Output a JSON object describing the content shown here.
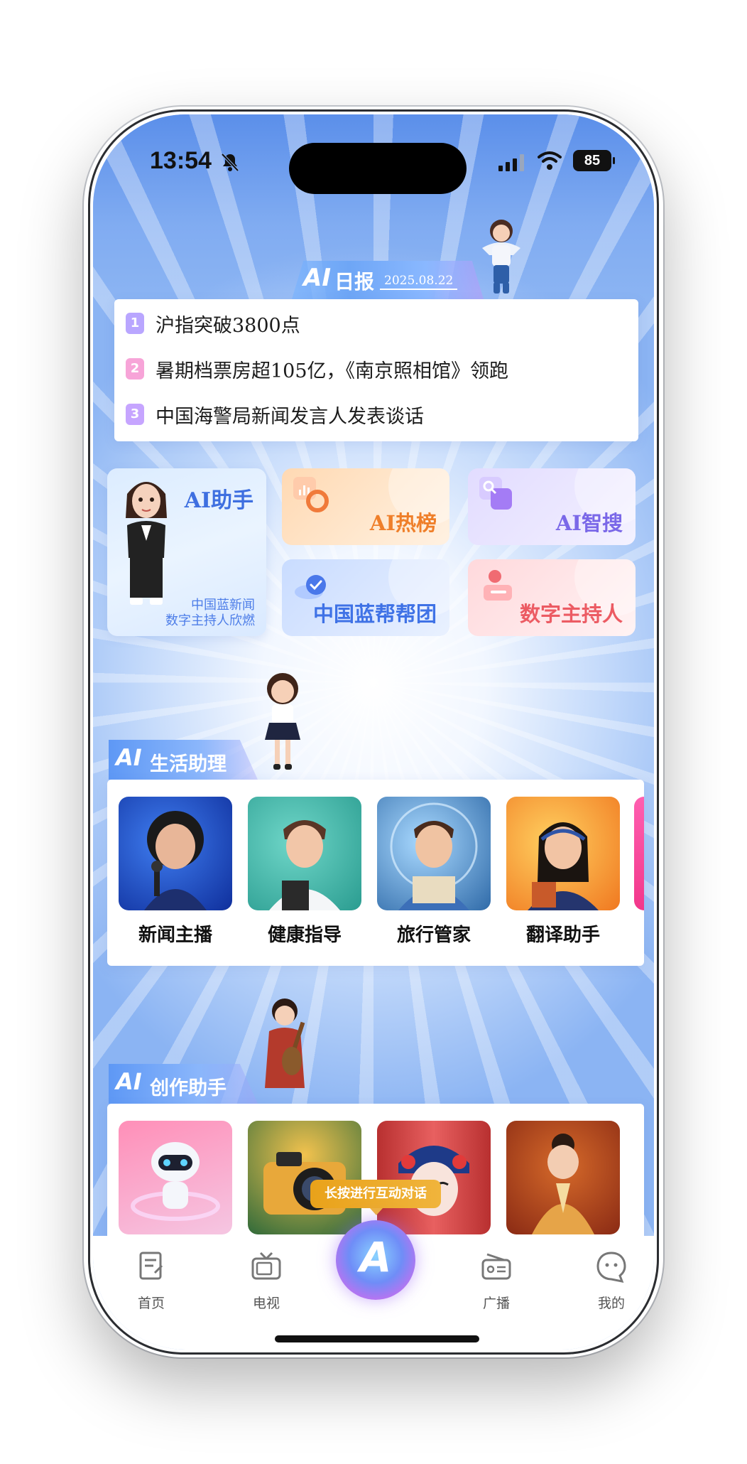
{
  "status_bar": {
    "time": "13:54",
    "battery": "85"
  },
  "daily": {
    "logo": "AI",
    "title": "日报",
    "date": "2025.08.22",
    "items": [
      {
        "num": "1",
        "text": "沪指突破3800点",
        "color": "#b9a6ff"
      },
      {
        "num": "2",
        "text": "暑期档票房超105亿，《南京照相馆》领跑",
        "color": "#f7a4d8"
      },
      {
        "num": "3",
        "text": "中国海警局新闻发言人发表谈话",
        "color": "#c6a5ff"
      }
    ]
  },
  "features": {
    "assistant": {
      "title": "AI助手",
      "subtitle_line1": "中国蓝新闻",
      "subtitle_line2": "数字主持人欣燃"
    },
    "hot": {
      "title": "AI热榜",
      "color": "#ef7f2a"
    },
    "search": {
      "title": "AI智搜",
      "color": "#7a68e8"
    },
    "help": {
      "title": "中国蓝帮帮团",
      "color": "#3f72e6"
    },
    "host": {
      "title": "数字主持人",
      "color": "#ec5b63"
    }
  },
  "life": {
    "logo": "AI",
    "title": "生活助理",
    "roles": [
      {
        "label": "新闻主播"
      },
      {
        "label": "健康指导"
      },
      {
        "label": "旅行管家"
      },
      {
        "label": "翻译助手"
      }
    ]
  },
  "create": {
    "logo": "AI",
    "title": "创作助手"
  },
  "tooltip": "长按进行互动对话",
  "tabbar": {
    "center_mark": "A",
    "items": [
      {
        "label": "首页"
      },
      {
        "label": "电视"
      },
      {
        "label": "广播"
      },
      {
        "label": "我的"
      }
    ]
  }
}
